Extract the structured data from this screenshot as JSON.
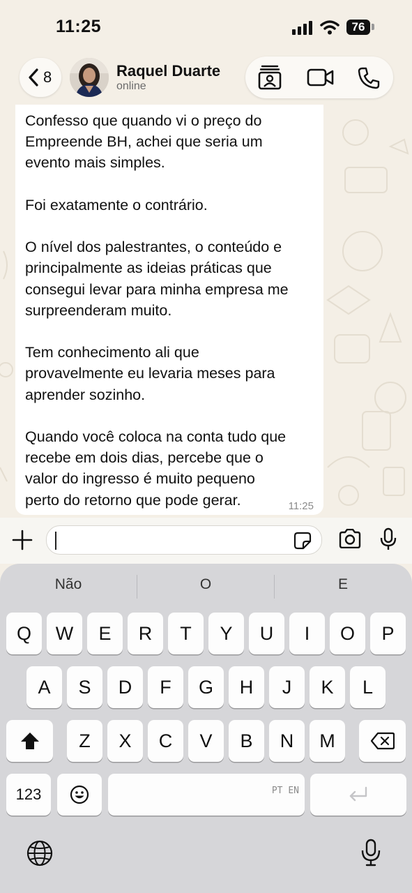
{
  "status_bar": {
    "time": "11:25",
    "battery": "76"
  },
  "header": {
    "back_count": "8",
    "contact_name": "Raquel Duarte",
    "contact_status": "online"
  },
  "message": {
    "text": "Confesso que quando vi o preço do\nEmpreende BH, achei que seria um\nevento mais simples.\n\nFoi exatamente o contrário.\n\nO nível dos palestrantes, o conteúdo e\nprincipalmente as ideias práticas que\nconsegui levar para minha empresa me\nsurpreenderam muito.\n\nTem conhecimento ali que\nprovavelmente eu levaria meses para\naprender sozinho.\n\nQuando você coloca na conta tudo que\nrecebe em dois dias, percebe que o\nvalor do ingresso é muito pequeno\nperto do retorno que pode gerar.",
    "time": "11:25"
  },
  "input": {
    "value": ""
  },
  "keyboard": {
    "suggestions": [
      "Não",
      "O",
      "E"
    ],
    "row1": [
      "Q",
      "W",
      "E",
      "R",
      "T",
      "Y",
      "U",
      "I",
      "O",
      "P"
    ],
    "row2": [
      "A",
      "S",
      "D",
      "F",
      "G",
      "H",
      "J",
      "K",
      "L"
    ],
    "row3": [
      "Z",
      "X",
      "C",
      "V",
      "B",
      "N",
      "M"
    ],
    "numbers_key": "123",
    "space_hint": "PT EN"
  }
}
